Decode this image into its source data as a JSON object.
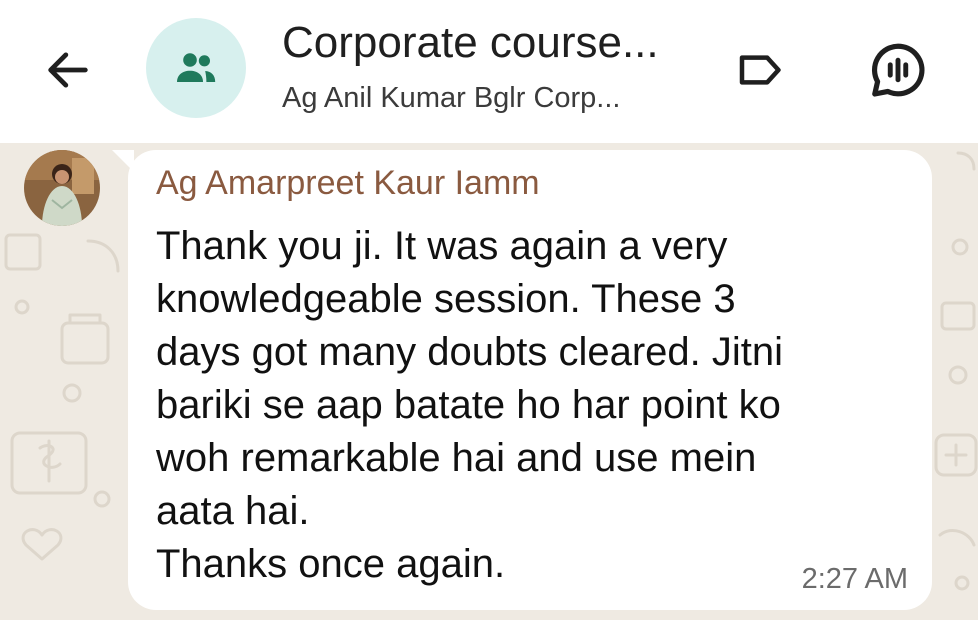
{
  "header": {
    "title": "Corporate course...",
    "subtitle": "Ag Anil Kumar Bglr Corp...",
    "back_icon": "arrow-left-icon",
    "avatar_icon": "group-icon",
    "label_icon": "label-icon",
    "voice_icon": "voice-chat-icon"
  },
  "message": {
    "sender": "Ag Amarpreet Kaur Iamm",
    "text": "Thank you ji. It was again a very\nknowledgeable session. These 3\ndays got many doubts cleared. Jitni\nbariki se aap batate ho har point ko\nwoh remarkable hai and use mein\naata hai.\nThanks once again.",
    "time": "2:27 AM"
  },
  "colors": {
    "header_bg": "#ffffff",
    "wallpaper": "#efeae2",
    "avatar_bg": "#d7f0ee",
    "group_icon": "#1f7a5c",
    "sender_name": "#8a5a40",
    "bubble": "#ffffff"
  }
}
